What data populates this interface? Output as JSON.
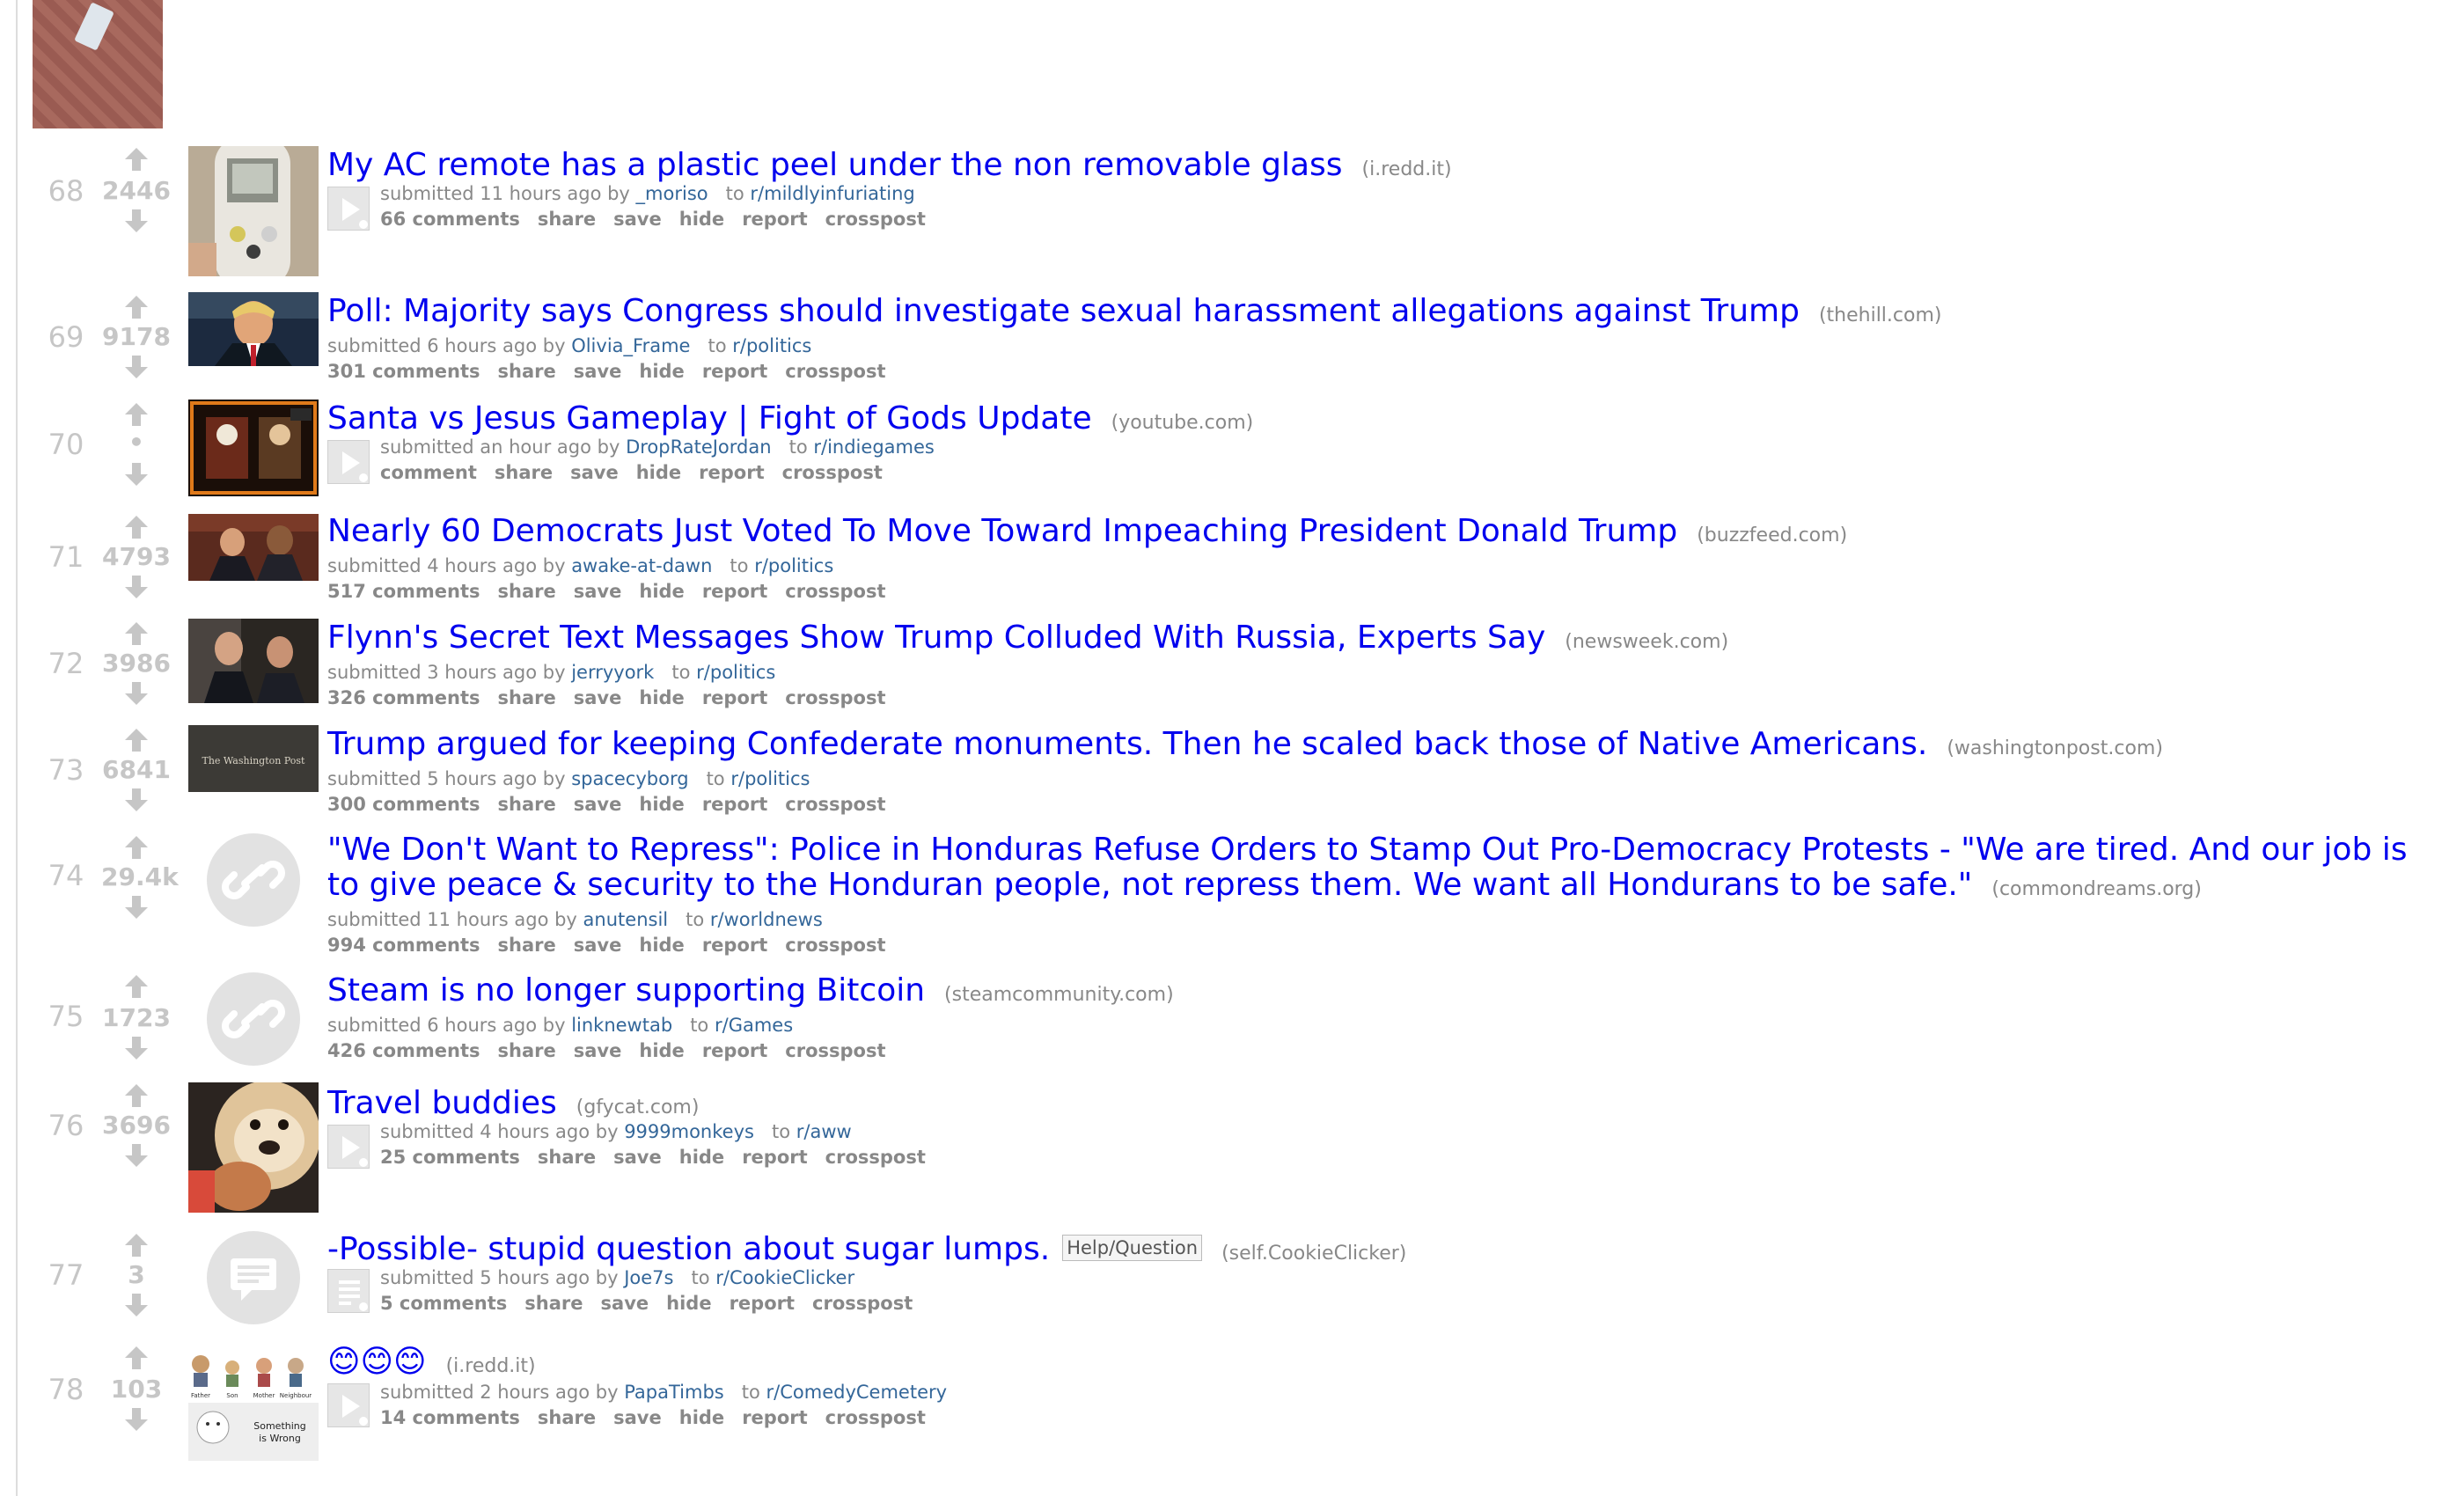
{
  "posts": [
    {
      "rank": "68",
      "score": "2446",
      "title": "My AC remote has a plastic peel under the non removable glass",
      "domain": "(i.redd.it)",
      "submitted": "submitted 11 hours ago by",
      "author": "_moriso",
      "to": "to",
      "subreddit": "r/mildlyinfuriating",
      "comments": "66 comments",
      "thumb": "ac-remote-photo",
      "expando": "video-expando"
    },
    {
      "rank": "69",
      "score": "9178",
      "title": "Poll: Majority says Congress should investigate sexual harassment allegations against Trump",
      "domain": "(thehill.com)",
      "submitted": "submitted 6 hours ago by",
      "author": "Olivia_Frame",
      "to": "to",
      "subreddit": "r/politics",
      "comments": "301 comments",
      "thumb": "trump-photo"
    },
    {
      "rank": "70",
      "score": "•",
      "title": "Santa vs Jesus Gameplay | Fight of Gods Update",
      "domain": "(youtube.com)",
      "submitted": "submitted an hour ago by",
      "author": "DropRateJordan",
      "to": "to",
      "subreddit": "r/indiegames",
      "comments": "comment",
      "thumb": "game-screenshot",
      "expando": "video-expando"
    },
    {
      "rank": "71",
      "score": "4793",
      "title": "Nearly 60 Democrats Just Voted To Move Toward Impeaching President Donald Trump",
      "domain": "(buzzfeed.com)",
      "submitted": "submitted 4 hours ago by",
      "author": "awake-at-dawn",
      "to": "to",
      "subreddit": "r/politics",
      "comments": "517 comments",
      "thumb": "congress-photo"
    },
    {
      "rank": "72",
      "score": "3986",
      "title": "Flynn's Secret Text Messages Show Trump Colluded With Russia, Experts Say",
      "domain": "(newsweek.com)",
      "submitted": "submitted 3 hours ago by",
      "author": "jerryyork",
      "to": "to",
      "subreddit": "r/politics",
      "comments": "326 comments",
      "thumb": "flynn-photo"
    },
    {
      "rank": "73",
      "score": "6841",
      "title": "Trump argued for keeping Confederate monuments. Then he scaled back those of Native Americans.",
      "domain": "(washingtonpost.com)",
      "submitted": "submitted 5 hours ago by",
      "author": "spacecyborg",
      "to": "to",
      "subreddit": "r/politics",
      "comments": "300 comments",
      "thumb": "washington-post-logo",
      "thumb_text": "The Washington Post"
    },
    {
      "rank": "74",
      "score": "29.4k",
      "title": "\"We Don't Want to Repress\": Police in Honduras Refuse Orders to Stamp Out Pro-Democracy Protests - \"We are tired. And our job is to give peace & security to the Honduran people, not repress them. We want all Hondurans to be safe.\"",
      "domain": "(commondreams.org)",
      "submitted": "submitted 11 hours ago by",
      "author": "anutensil",
      "to": "to",
      "subreddit": "r/worldnews",
      "comments": "994 comments",
      "thumb": "link-icon"
    },
    {
      "rank": "75",
      "score": "1723",
      "title": "Steam is no longer supporting Bitcoin",
      "domain": "(steamcommunity.com)",
      "submitted": "submitted 6 hours ago by",
      "author": "linknewtab",
      "to": "to",
      "subreddit": "r/Games",
      "comments": "426 comments",
      "thumb": "link-icon"
    },
    {
      "rank": "76",
      "score": "3696",
      "title": "Travel buddies",
      "domain": "(gfycat.com)",
      "submitted": "submitted 4 hours ago by",
      "author": "9999monkeys",
      "to": "to",
      "subreddit": "r/aww",
      "comments": "25 comments",
      "thumb": "dog-photo",
      "expando": "video-expando"
    },
    {
      "rank": "77",
      "score": "3",
      "title": "-Possible- stupid question about sugar lumps.",
      "flair": "Help/Question",
      "domain": "(self.CookieClicker)",
      "submitted": "submitted 5 hours ago by",
      "author": "Joe7s",
      "to": "to",
      "subreddit": "r/CookieClicker",
      "comments": "5 comments",
      "thumb": "self-post-icon",
      "expando": "text-expando"
    },
    {
      "rank": "78",
      "score": "103",
      "title": "😊😊😊",
      "domain": "(i.redd.it)",
      "submitted": "submitted 2 hours ago by",
      "author": "PapaTimbs",
      "to": "to",
      "subreddit": "r/ComedyCemetery",
      "comments": "14 comments",
      "thumb": "comic-image",
      "thumb_labels": [
        "Father",
        "Son",
        "Mother",
        "Neighbour"
      ],
      "thumb_caption": [
        "Something",
        "is Wrong"
      ],
      "expando": "video-expando"
    }
  ],
  "actions": [
    "share",
    "save",
    "hide",
    "report",
    "crosspost"
  ],
  "colors": {
    "title": "#0000ee",
    "link": "#336699",
    "muted": "#888888",
    "vote": "#c6c6c6"
  }
}
